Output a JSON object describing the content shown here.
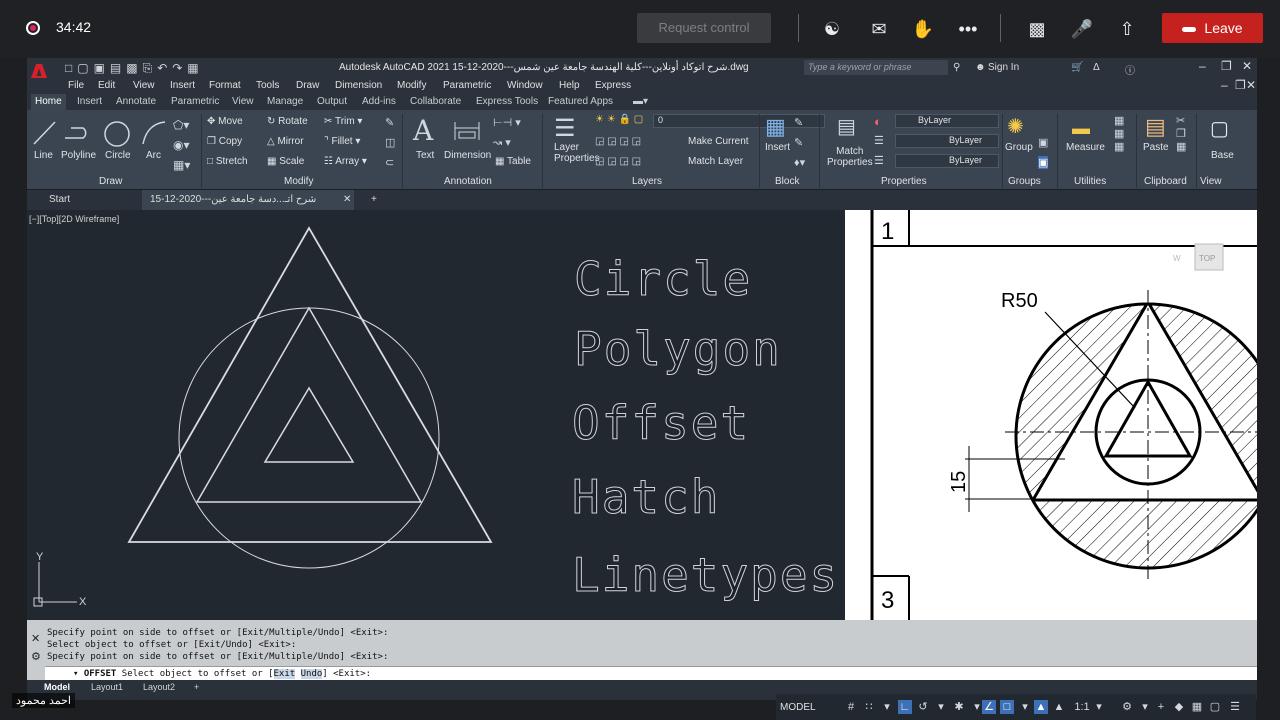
{
  "meet": {
    "rec_time": "34:42",
    "request_control": "Request control",
    "leave": "Leave",
    "participant_name": "احمد محمود"
  },
  "autocad": {
    "app_title": "Autodesk AutoCAD 2021    15-12-2020---شرح اتوكاد أونلاين---كلية الهندسة جامعة عين شمس.dwg",
    "search_placeholder": "Type a keyword or phrase",
    "sign_in": "Sign In",
    "menu": [
      "File",
      "Edit",
      "View",
      "Insert",
      "Format",
      "Tools",
      "Draw",
      "Dimension",
      "Modify",
      "Parametric",
      "Window",
      "Help",
      "Express"
    ],
    "ribbon_tabs": [
      "Home",
      "Insert",
      "Annotate",
      "Parametric",
      "View",
      "Manage",
      "Output",
      "Add-ins",
      "Collaborate",
      "Express Tools",
      "Featured Apps"
    ],
    "draw_tools": [
      "Line",
      "Polyline",
      "Circle",
      "Arc"
    ],
    "modify_tools": [
      "Move",
      "Rotate",
      "Trim",
      "Copy",
      "Mirror",
      "Fillet",
      "Stretch",
      "Scale",
      "Array"
    ],
    "annotation_tools": [
      "Text",
      "Dimension",
      "Table"
    ],
    "layer_tools": [
      "Layer Properties",
      "Make Current",
      "Match Layer"
    ],
    "layer_current": "0",
    "block_tool": "Insert",
    "properties_tool": "Match Properties",
    "bylayer": "ByLayer",
    "groups_tool": "Group",
    "utilities_tool": "Measure",
    "clipboard_tool": "Paste",
    "view_tool": "Base",
    "panels": [
      "Draw",
      "Modify",
      "Annotation",
      "Layers",
      "Block",
      "Properties",
      "Groups",
      "Utilities",
      "Clipboard",
      "View"
    ],
    "doc_tabs": [
      "Start",
      "15-12-2020---شرح اتـ...دسة جامعة عين شمس*"
    ],
    "viewport_label": "[−][Top][2D Wireframe]",
    "topics": [
      "Circle",
      "Polygon",
      "Offset",
      "Hatch",
      "Linetypes"
    ],
    "sheet_labels": {
      "box1": "1",
      "box3": "3",
      "radius": "R50",
      "dim": "15",
      "viewcube": "TOP",
      "w": "W"
    },
    "command_history": [
      "Specify point on side to offset or [Exit/Multiple/Undo] <Exit>:",
      "Select object to offset or [Exit/Undo] <Exit>:",
      "Specify point on side to offset or [Exit/Multiple/Undo] <Exit>:"
    ],
    "command_prompt_cmd": "OFFSET",
    "command_prompt_pre": "Select object to offset or [",
    "command_prompt_exit": "Exit",
    "command_prompt_undo": "Undo",
    "command_prompt_post": "] <Exit>:",
    "layout_tabs": [
      "Model",
      "Layout1",
      "Layout2"
    ],
    "status_model": "MODEL",
    "scale": "1:1"
  }
}
